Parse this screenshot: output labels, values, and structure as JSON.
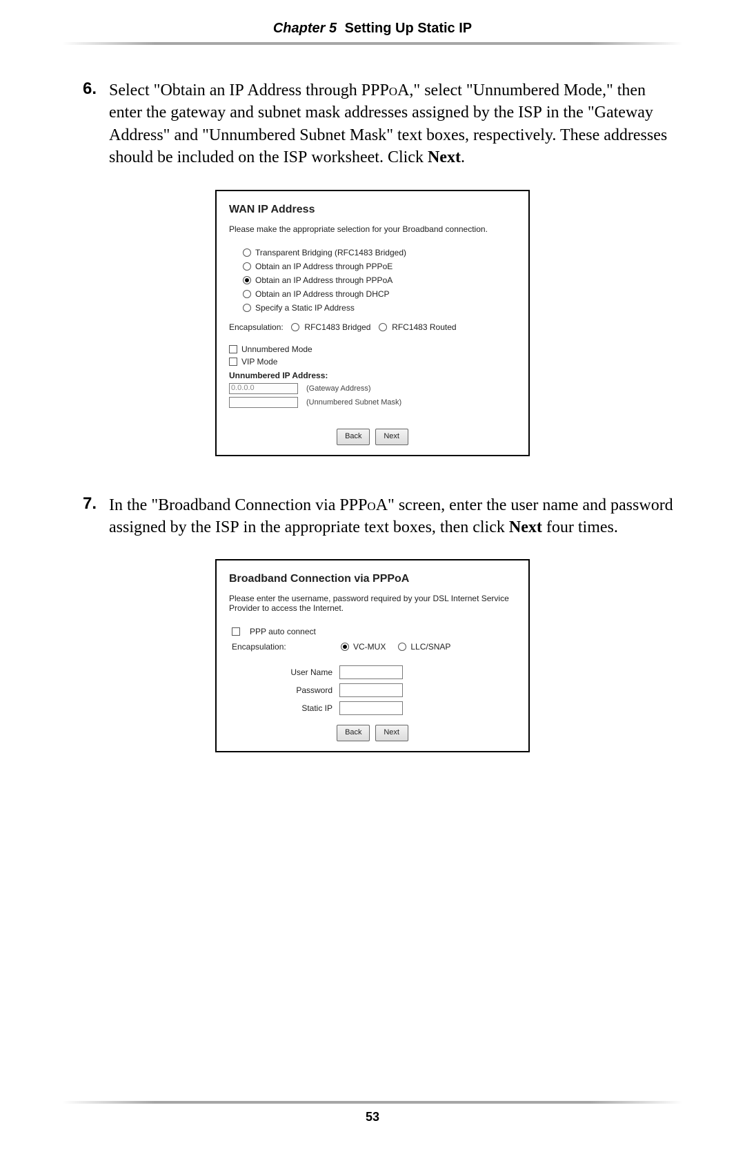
{
  "header": {
    "chapter_label": "Chapter 5",
    "chapter_title": "Setting Up Static IP"
  },
  "step6": {
    "number": "6.",
    "text_before": "Select \"Obtain an ",
    "ip": "IP",
    "text_after_ip": " Address through ",
    "pppoa": "PPPoA",
    "text_after_pppoa": ",\" select \"Unnumbered Mode,\" then enter the gateway and subnet mask addresses assigned by the ",
    "isp1": "ISP",
    "text_after_isp1": " in the \"Gateway Address\" and \"Unnumbered Subnet Mask\" text boxes, respectively. These addresses should be included on the ",
    "isp2": "ISP",
    "text_after_isp2": " worksheet. Click ",
    "next_bold": "Next",
    "period": "."
  },
  "wan_dialog": {
    "title": "WAN IP Address",
    "desc": "Please make the appropriate selection for your Broadband connection.",
    "options": [
      "Transparent Bridging (RFC1483 Bridged)",
      "Obtain an IP Address through PPPoE",
      "Obtain an IP Address through PPPoA",
      "Obtain an IP Address through DHCP",
      "Specify a Static IP Address"
    ],
    "encap_label": "Encapsulation:",
    "encap_opt1": "RFC1483 Bridged",
    "encap_opt2": "RFC1483 Routed",
    "unnumbered_mode": "Unnumbered Mode",
    "vip_mode": "VIP Mode",
    "unnum_ip_label": "Unnumbered IP Address:",
    "gw_value": "0.0.0.0",
    "gw_hint": "(Gateway Address)",
    "mask_hint": "(Unnumbered Subnet Mask)",
    "back": "Back",
    "next": "Next"
  },
  "step7": {
    "number": "7.",
    "t1": "In the \"Broadband Connection via ",
    "pppoa": "PPPoA",
    "t2": "\" screen, enter the user name and password assigned by the ",
    "isp": "ISP",
    "t3": " in the appropriate text boxes, then click ",
    "next_bold": "Next",
    "t4": " four times."
  },
  "pppoa_dialog": {
    "title": "Broadband Connection via PPPoA",
    "desc": "Please enter the username, password required by your DSL Internet Service Provider to access the Internet.",
    "auto_connect": "PPP auto connect",
    "encap_label": "Encapsulation:",
    "encap_opt1": "VC-MUX",
    "encap_opt2": "LLC/SNAP",
    "user_label": "User Name",
    "pass_label": "Password",
    "static_label": "Static IP",
    "back": "Back",
    "next": "Next"
  },
  "page_number": "53"
}
